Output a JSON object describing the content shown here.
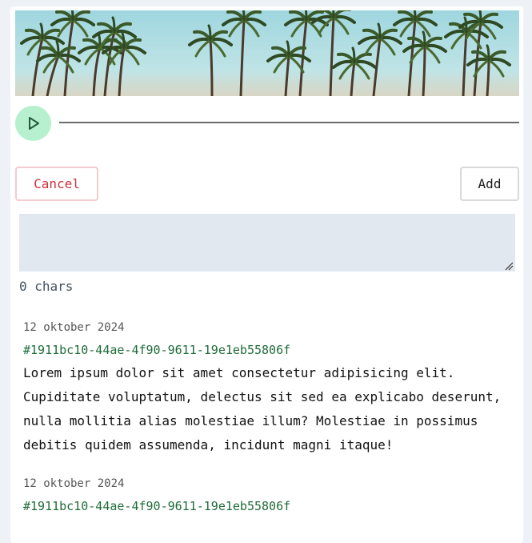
{
  "player": {
    "play_icon": "play-icon"
  },
  "actions": {
    "cancel_label": "Cancel",
    "add_label": "Add"
  },
  "note": {
    "value": "",
    "char_count": "0 chars"
  },
  "entries": [
    {
      "date": "12 oktober 2024",
      "id": "#1911bc10-44ae-4f90-9611-19e1eb55806f",
      "text": "Lorem ipsum dolor sit amet consectetur adipisicing elit. Cupiditate voluptatum, delectus sit sed ea explicabo deserunt, nulla mollitia alias molestiae illum? Molestiae in possimus debitis quidem assumenda, incidunt magni itaque!"
    },
    {
      "date": "12 oktober 2024",
      "id": "#1911bc10-44ae-4f90-9611-19e1eb55806f",
      "text": ""
    }
  ],
  "colors": {
    "play_bg": "#b7f0cf",
    "cancel": "#c8333d",
    "id_green": "#1f6b3a",
    "input_bg": "#e2e8f0"
  }
}
